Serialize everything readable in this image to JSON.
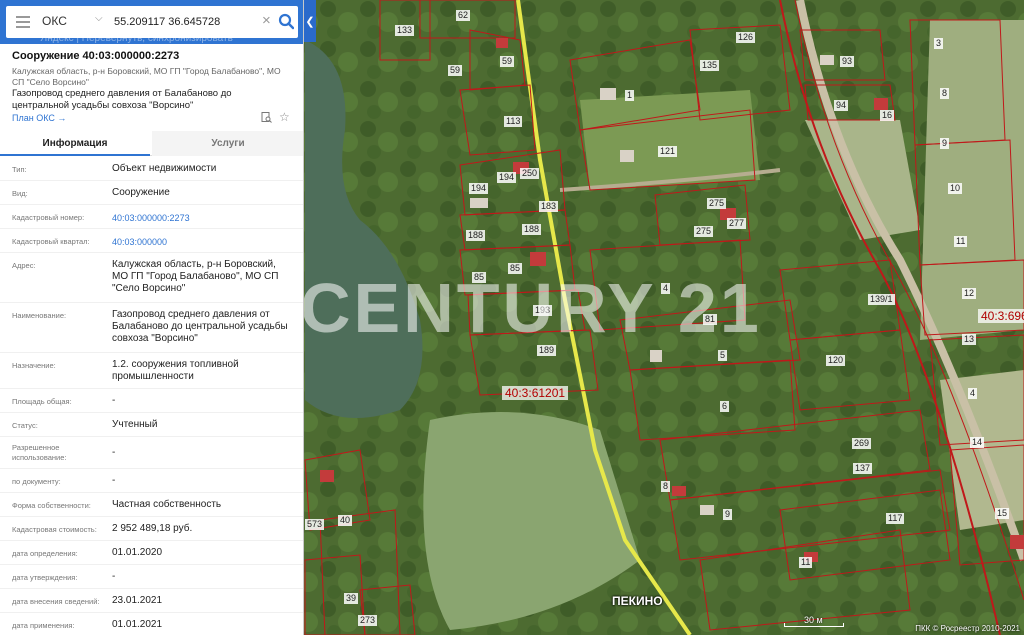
{
  "search": {
    "type": "ОКС",
    "query": "55.209117 36.645728",
    "hint": "Яндекс | Перевернуть, синхронизировать"
  },
  "object": {
    "title": "Сооружение 40:03:000000:2273",
    "address": "Калужская область, р-н Боровский, МО ГП \"Город Балабаново\", МО СП \"Село Ворсино\"",
    "description": "Газопровод среднего давления от Балабаново до центральной усадьбы совхоза \"Ворсино\"",
    "plan_link": "План ОКС →"
  },
  "tabs": {
    "info": "Информация",
    "services": "Услуги"
  },
  "details": [
    {
      "label": "Тип:",
      "value": "Объект недвижимости"
    },
    {
      "label": "Вид:",
      "value": "Сооружение"
    },
    {
      "label": "Кадастровый номер:",
      "value": "40:03:000000:2273"
    },
    {
      "label": "Кадастровый квартал:",
      "value": "40:03:000000"
    },
    {
      "label": "Адрес:",
      "value": "Калужская область, р-н Боровский, МО ГП \"Город Балабаново\", МО СП \"Село Ворсино\""
    },
    {
      "label": "Наименование:",
      "value": "Газопровод среднего давления от Балабаново до центральной усадьбы совхоза \"Ворсино\""
    },
    {
      "label": "Назначение:",
      "value": "1.2. сооружения топливной промышленности"
    },
    {
      "label": "Площадь общая:",
      "value": "-"
    },
    {
      "label": "Статус:",
      "value": "Учтенный"
    },
    {
      "label": "Разрешенное использование:",
      "value": "-"
    },
    {
      "label": "по документу:",
      "value": "-"
    },
    {
      "label": "Форма собственности:",
      "value": "Частная собственность"
    },
    {
      "label": "Кадастровая стоимость:",
      "value": "2 952 489,18 руб."
    },
    {
      "label": "дата определения:",
      "value": "01.01.2020"
    },
    {
      "label": "дата утверждения:",
      "value": "-"
    },
    {
      "label": "дата внесения сведений:",
      "value": "23.01.2021"
    },
    {
      "label": "дата применения:",
      "value": "01.01.2021"
    }
  ],
  "map": {
    "watermark": "CENTURY 21",
    "village": "ПЕКИНО",
    "quarter_main": "40:3:61201",
    "quarter_right": "40:3:696",
    "scale": "30 м",
    "copyright": "ПКК © Росреестр 2010-2021",
    "plots": [
      "62",
      "133",
      "59",
      "126",
      "3",
      "59",
      "93",
      "135",
      "94",
      "8",
      "1",
      "113",
      "121",
      "16",
      "9",
      "194",
      "194",
      "250",
      "183",
      "275",
      "10",
      "188",
      "188",
      "275",
      "277",
      "11",
      "85",
      "85",
      "4",
      "139/1",
      "193",
      "81",
      "12",
      "189",
      "5",
      "120",
      "13",
      "6",
      "4",
      "269",
      "137",
      "14",
      "8",
      "9",
      "117",
      "15",
      "11",
      "40",
      "573",
      "39",
      "273",
      "139/1"
    ]
  }
}
